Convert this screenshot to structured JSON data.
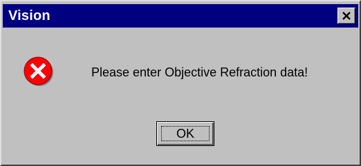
{
  "window": {
    "title": "Vision",
    "close_icon": "close-icon"
  },
  "dialog": {
    "icon": "error-icon",
    "message": "Please enter Objective Refraction data!",
    "ok_label": "OK"
  },
  "colors": {
    "titlebar": "#000080",
    "face": "#c0c0c0",
    "error_red": "#ff0000"
  }
}
